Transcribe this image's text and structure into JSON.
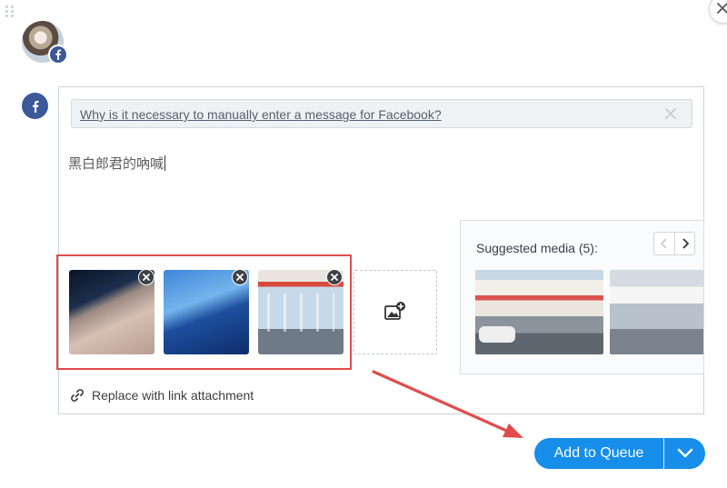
{
  "composer": {
    "notice_text": "Why is it necessary to manually enter a message for Facebook?",
    "message_text": "黑白郎君的吶喊"
  },
  "attached_media": [
    {
      "name": "thumb-1"
    },
    {
      "name": "thumb-2"
    },
    {
      "name": "thumb-3"
    }
  ],
  "suggested_media": {
    "title": "Suggested media (5):"
  },
  "replace_link_label": "Replace with link attachment",
  "queue_button_label": "Add to Queue",
  "colors": {
    "facebook_blue": "#3b5998",
    "primary_blue": "#168eea",
    "annotation_red": "#e04c4c"
  },
  "icons": [
    "close-icon",
    "facebook-icon",
    "image-add-icon",
    "chevron-left-icon",
    "chevron-right-icon",
    "link-icon",
    "chevron-down-icon",
    "drag-handle-icon"
  ]
}
